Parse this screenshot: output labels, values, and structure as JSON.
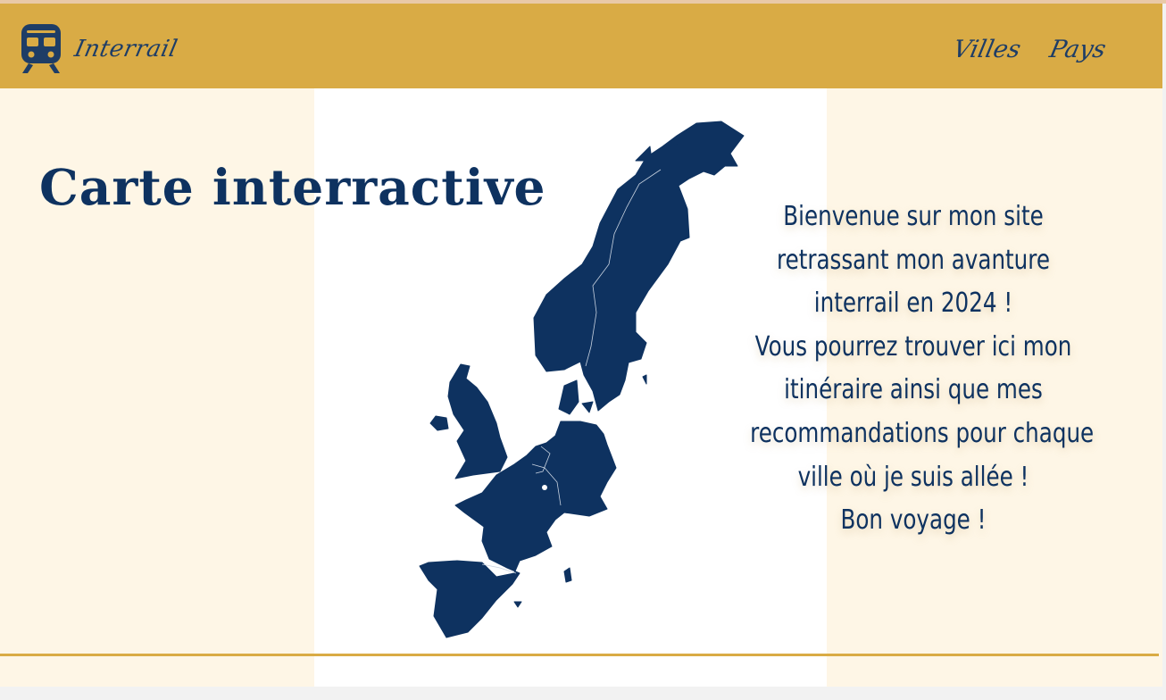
{
  "header": {
    "brand": "Interrail",
    "nav": [
      "Villes",
      "Pays"
    ]
  },
  "main": {
    "title": "Carte interractive",
    "intro_lines": [
      "Bienvenue sur mon site",
      "retrassant mon avanture",
      "interrail en 2024 !",
      "Vous pourrez trouver ici mon",
      "itinéraire ainsi que mes",
      "recommandations pour chaque",
      "ville où je suis allée !",
      "Bon voyage !"
    ]
  },
  "icons": {
    "logo": "train-icon",
    "map": "europe-map"
  },
  "colors": {
    "navbar": "#d9ab45",
    "navy": "#0e3260",
    "cream": "#fef6e6",
    "panel": "#ffffff"
  }
}
